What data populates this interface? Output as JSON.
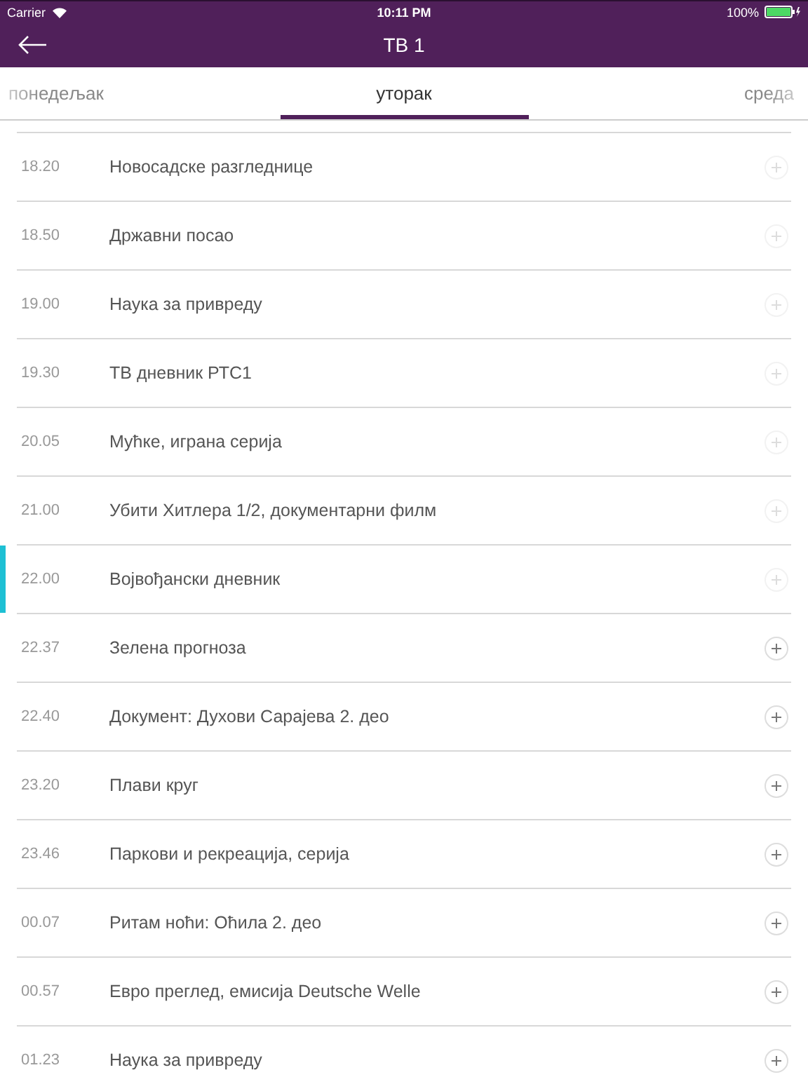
{
  "status_bar": {
    "carrier": "Carrier",
    "time": "10:11 PM",
    "battery": "100%"
  },
  "header": {
    "title": "ТВ 1"
  },
  "tabs": [
    {
      "label": "понедељак",
      "selected": false
    },
    {
      "label": "уторак",
      "selected": true
    },
    {
      "label": "среда",
      "selected": false
    }
  ],
  "schedule": [
    {
      "time": "18.20",
      "title": "Новосадске разгледнице",
      "current": false,
      "disabled": true
    },
    {
      "time": "18.50",
      "title": "Државни посао",
      "current": false,
      "disabled": true
    },
    {
      "time": "19.00",
      "title": "Наука за привреду",
      "current": false,
      "disabled": true
    },
    {
      "time": "19.30",
      "title": "ТВ дневник РТС1",
      "current": false,
      "disabled": true
    },
    {
      "time": "20.05",
      "title": "Мућке, играна серија",
      "current": false,
      "disabled": true
    },
    {
      "time": "21.00",
      "title": "Убити Хитлера 1/2, документарни филм",
      "current": false,
      "disabled": true
    },
    {
      "time": "22.00",
      "title": "Војвођански дневник",
      "current": true,
      "disabled": true
    },
    {
      "time": "22.37",
      "title": "Зелена прогноза",
      "current": false,
      "disabled": false
    },
    {
      "time": "22.40",
      "title": "Документ: Духови Сарајева 2. део",
      "current": false,
      "disabled": false
    },
    {
      "time": "23.20",
      "title": "Плави круг",
      "current": false,
      "disabled": false
    },
    {
      "time": "23.46",
      "title": "Паркови и рекреација, серија",
      "current": false,
      "disabled": false
    },
    {
      "time": "00.07",
      "title": "Ритам ноћи: Оћила 2. део",
      "current": false,
      "disabled": false
    },
    {
      "time": "00.57",
      "title": "Евро преглед, емисија Deutsche Welle",
      "current": false,
      "disabled": false
    },
    {
      "time": "01.23",
      "title": "Наука за привреду",
      "current": false,
      "disabled": false
    }
  ]
}
